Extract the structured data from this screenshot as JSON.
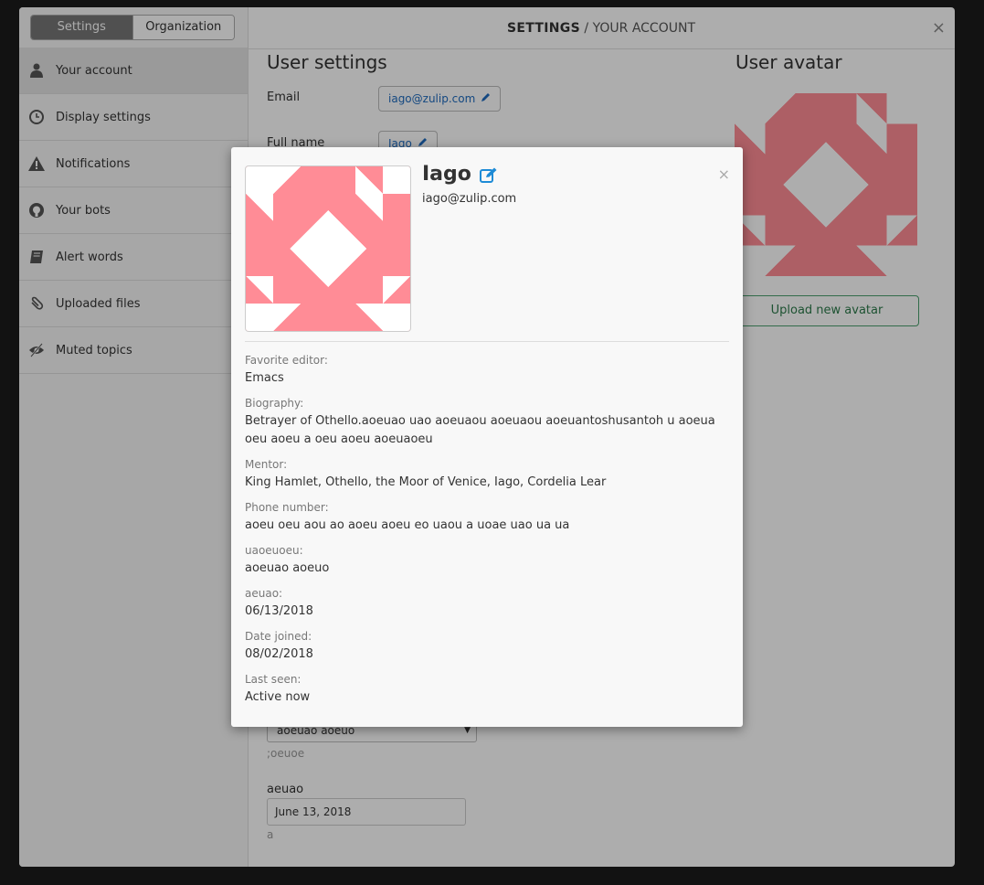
{
  "settings": {
    "toggle": {
      "settings_label": "Settings",
      "organization_label": "Organization"
    },
    "header": {
      "section": "SETTINGS",
      "sub": "/ YOUR ACCOUNT",
      "close": "×"
    },
    "sidebar": [
      {
        "label": "Your account",
        "icon": "user-icon"
      },
      {
        "label": "Display settings",
        "icon": "clock-icon"
      },
      {
        "label": "Notifications",
        "icon": "warning-icon"
      },
      {
        "label": "Your bots",
        "icon": "github-icon"
      },
      {
        "label": "Alert words",
        "icon": "book-icon"
      },
      {
        "label": "Uploaded files",
        "icon": "paperclip-icon"
      },
      {
        "label": "Muted topics",
        "icon": "eye-slash-icon"
      }
    ],
    "user_settings": {
      "title": "User settings",
      "email_label": "Email",
      "email_value": "iago@zulip.com",
      "fullname_label": "Full name",
      "fullname_value": "Iago"
    },
    "avatar": {
      "title": "User avatar",
      "upload_label": "Upload new avatar"
    },
    "lower": {
      "select_value": "aoeuao aoeuo",
      "select_hint": ";oeuoe",
      "date_label": "aeuao",
      "date_value": "June 13, 2018",
      "date_hint": "a"
    }
  },
  "profile": {
    "name": "Iago",
    "email": "iago@zulip.com",
    "close": "×",
    "fields": [
      {
        "label": "Favorite editor:",
        "value": "Emacs"
      },
      {
        "label": "Biography:",
        "value": "Betrayer of Othello.aoeuao uao aoeuaou aoeuaou aoeuantoshusantoh u aoeua oeu aoeu a oeu aoeu aoeuaoeu"
      },
      {
        "label": "Mentor:",
        "value": "King Hamlet, Othello, the Moor of Venice, Iago, Cordelia Lear"
      },
      {
        "label": "Phone number:",
        "value": "aoeu oeu aou ao aoeu aoeu eo uaou a uoae uao ua ua"
      },
      {
        "label": "uaoeuoeu:",
        "value": "aoeuao aoeuo"
      },
      {
        "label": "aeuao:",
        "value": "06/13/2018"
      },
      {
        "label": "Date joined:",
        "value": "08/02/2018"
      },
      {
        "label": "Last seen:",
        "value": "Active now"
      }
    ]
  },
  "colors": {
    "avatar_pink": "#ff8c96",
    "link_blue": "#1e6bbf",
    "accent_green": "#4a9f6e"
  }
}
